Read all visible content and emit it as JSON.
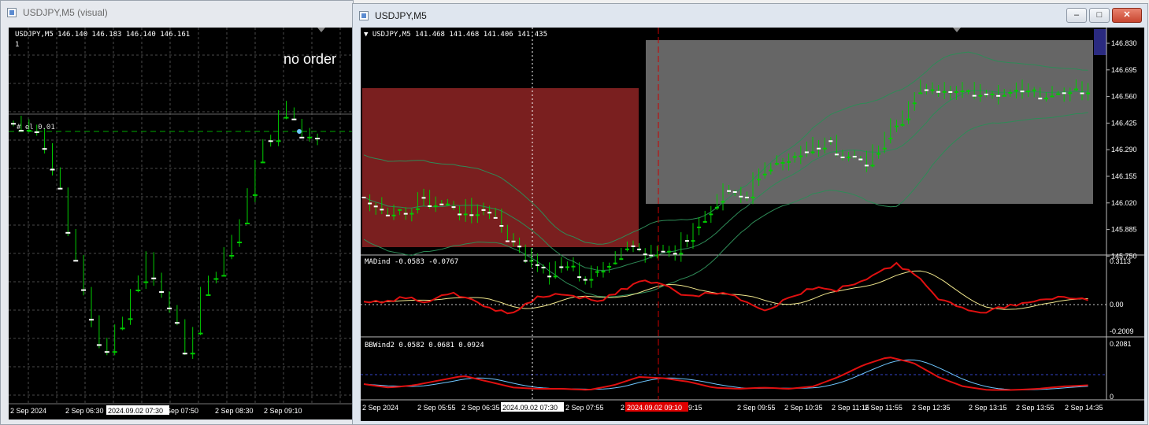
{
  "left_window": {
    "title": "USDJPY,M5 (visual)",
    "header": "USDJPY,M5  146.140 146.183 146.140 146.161",
    "header_line2": "1",
    "order_status": "no order",
    "order_label": "#    el 0.01",
    "x_labels": [
      "2 Sep 2024",
      "2 Sep 06:30",
      "2024.09.02 07:30",
      "Sep 07:50",
      "2 Sep 08:30",
      "2 Sep 09:10"
    ]
  },
  "right_window": {
    "title": "USDJPY,M5",
    "controls": {
      "minimize": "–",
      "maximize": "□",
      "close": "✕"
    },
    "main_header": "USDJPY,M5  141.468 141.468 141.406 141.435",
    "price_ticks": [
      "146.830",
      "146.695",
      "146.560",
      "146.425",
      "146.290",
      "146.155",
      "146.020",
      "145.885",
      "145.750"
    ],
    "indicator1": {
      "header": "MADind -0.0583 -0.0767",
      "ticks": [
        "0.3113",
        "0.00",
        "-0.2009"
      ]
    },
    "indicator2": {
      "header": "BBWind2 0.0582 0.0681 0.0924",
      "ticks": [
        "0.2081",
        "0"
      ]
    },
    "x_labels": [
      "2 Sep 2024",
      "2 Sep 05:55",
      "2 Sep 06:35",
      "2024.09.02 07:30",
      "2 Sep 07:55",
      "2 Se",
      "2024.09.02 09:10",
      "9:15",
      "2 Sep 09:55",
      "2 Sep 10:35",
      "2 Sep 11:15",
      "2 Sep 11:55",
      "2 Sep 12:35",
      "2 Sep 13:15",
      "2 Sep 13:55",
      "2 Sep 14:35"
    ]
  },
  "colors": {
    "chart_bg": "#000000",
    "grid": "#4a4a4a",
    "bull_candle": "#ffffff",
    "wick": "#00cc00",
    "sell_zone": "#7a1f1f",
    "range_zone": "#666666",
    "bollinger": "#2e8b57",
    "indicator_red": "#e01010",
    "indicator_yellow": "#f0e68c",
    "indicator_cyan": "#6ec6ff",
    "crosshair": "#ffffff",
    "event_line": "#cc0000"
  }
}
